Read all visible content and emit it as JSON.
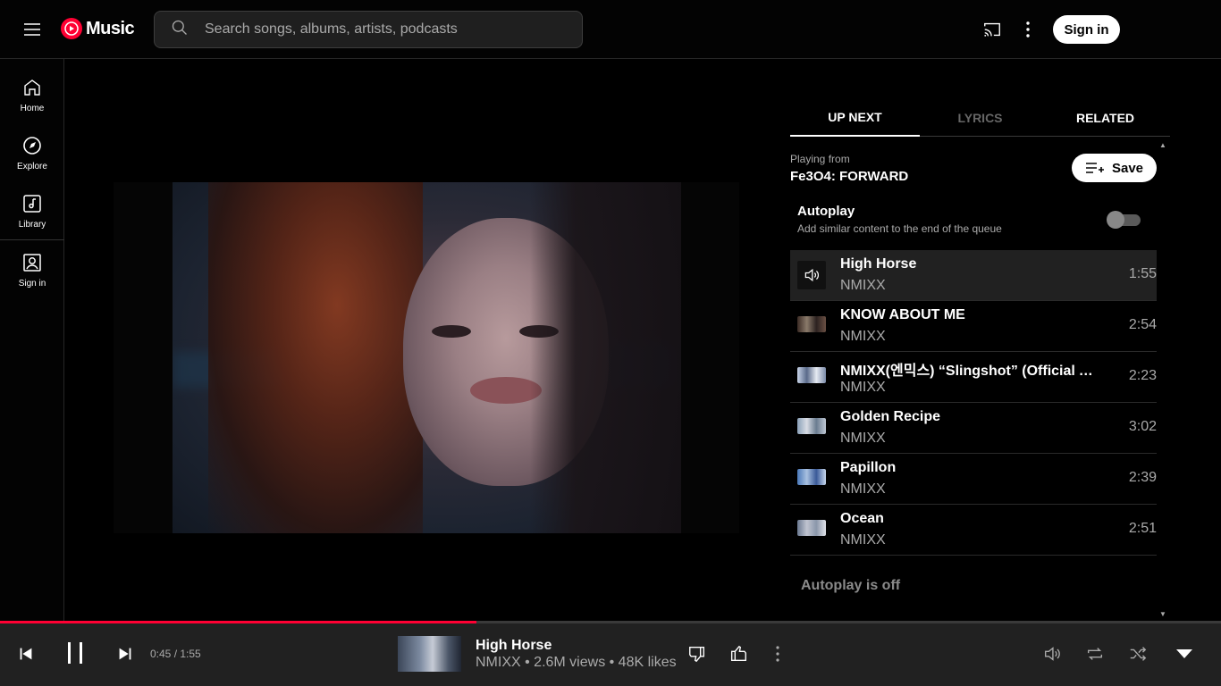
{
  "header": {
    "logo_text": "Music",
    "search_placeholder": "Search songs, albums, artists, podcasts",
    "sign_in": "Sign in"
  },
  "sidebar": {
    "items": [
      {
        "label": "Home",
        "icon": "home-icon"
      },
      {
        "label": "Explore",
        "icon": "compass-icon"
      },
      {
        "label": "Library",
        "icon": "library-icon"
      },
      {
        "label": "Sign in",
        "icon": "account-icon"
      }
    ]
  },
  "tabs": [
    "UP NEXT",
    "LYRICS",
    "RELATED"
  ],
  "playing_from": {
    "label": "Playing from",
    "title": "Fe3O4: FORWARD",
    "save_label": "Save"
  },
  "autoplay": {
    "title": "Autoplay",
    "subtitle": "Add similar content to the end of the queue",
    "enabled": false,
    "off_text": "Autoplay is off"
  },
  "queue": [
    {
      "title": "High Horse",
      "artist": "NMIXX",
      "duration": "1:55",
      "playing": true
    },
    {
      "title": "KNOW ABOUT ME",
      "artist": "NMIXX",
      "duration": "2:54"
    },
    {
      "title": "NMIXX(엔믹스) “Slingshot” (Official Au…",
      "artist": "NMIXX",
      "duration": "2:23"
    },
    {
      "title": "Golden Recipe",
      "artist": "NMIXX",
      "duration": "3:02"
    },
    {
      "title": "Papillon",
      "artist": "NMIXX",
      "duration": "2:39"
    },
    {
      "title": "Ocean",
      "artist": "NMIXX",
      "duration": "2:51"
    }
  ],
  "player": {
    "time": "0:45 / 1:55",
    "progress": 0.39,
    "title": "High Horse",
    "subtitle": "NMIXX • 2.6M views • 48K likes"
  },
  "colors": {
    "accent": "#ff0033",
    "background": "#030303",
    "bar": "#212121"
  }
}
